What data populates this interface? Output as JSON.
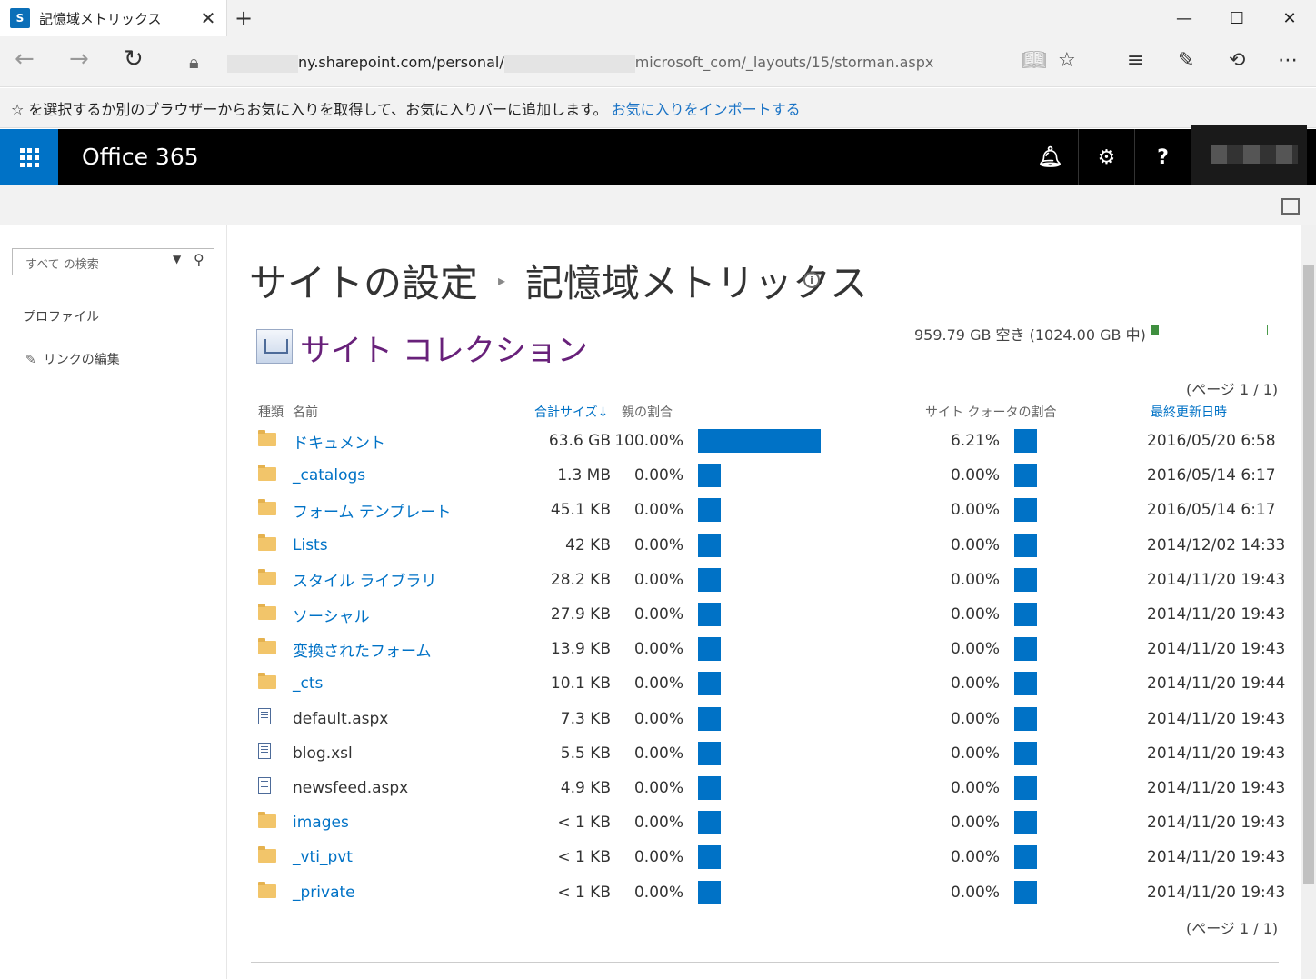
{
  "browser": {
    "tab_title": "記憶域メトリックス",
    "favicon_label": "S",
    "url_prefix": "ny.sharepoint.com/personal/",
    "url_suffix": "microsoft_com/_layouts/15/storman.aspx",
    "favorites_message": "☆ を選択するか別のブラウザーからお気に入りを取得して、お気に入りバーに追加します。",
    "favorites_import_link": "お気に入りをインポートする"
  },
  "suite": {
    "title": "Office 365"
  },
  "leftnav": {
    "search_placeholder": "すべて の検索",
    "items": [
      {
        "label": "プロファイル"
      },
      {
        "label": "リンクの編集"
      }
    ]
  },
  "page": {
    "breadcrumb_parent": "サイトの設定",
    "breadcrumb_current": "記憶域メトリックス",
    "section_title": "サイト コレクション",
    "quota_text": "959.79 GB 空き (1024.00 GB 中)",
    "quota_used_fraction": 0.06,
    "page_indicator_top": "(ページ 1 / 1)",
    "page_indicator_bottom": "(ページ 1 / 1)"
  },
  "table": {
    "headers": {
      "type": "種類",
      "name": "名前",
      "total_size": "合計サイズ",
      "parent_pct": "親の割合",
      "quota_pct": "サイト クォータの割合",
      "last_modified": "最終更新日時"
    },
    "rows": [
      {
        "kind": "folder",
        "name": "ドキュメント",
        "link": true,
        "size": "63.6 GB",
        "parent_pct": "100.00%",
        "parent_frac": 1.0,
        "quota_pct": "6.21%",
        "date": "2016/05/20 6:58"
      },
      {
        "kind": "folder",
        "name": "_catalogs",
        "link": true,
        "size": "1.3 MB",
        "parent_pct": "0.00%",
        "parent_frac": 0,
        "quota_pct": "0.00%",
        "date": "2016/05/14 6:17"
      },
      {
        "kind": "folder",
        "name": "フォーム テンプレート",
        "link": true,
        "size": "45.1 KB",
        "parent_pct": "0.00%",
        "parent_frac": 0,
        "quota_pct": "0.00%",
        "date": "2016/05/14 6:17"
      },
      {
        "kind": "folder",
        "name": "Lists",
        "link": true,
        "size": "42 KB",
        "parent_pct": "0.00%",
        "parent_frac": 0,
        "quota_pct": "0.00%",
        "date": "2014/12/02 14:33"
      },
      {
        "kind": "folder",
        "name": "スタイル ライブラリ",
        "link": true,
        "size": "28.2 KB",
        "parent_pct": "0.00%",
        "parent_frac": 0,
        "quota_pct": "0.00%",
        "date": "2014/11/20 19:43"
      },
      {
        "kind": "folder",
        "name": "ソーシャル",
        "link": true,
        "size": "27.9 KB",
        "parent_pct": "0.00%",
        "parent_frac": 0,
        "quota_pct": "0.00%",
        "date": "2014/11/20 19:43"
      },
      {
        "kind": "folder",
        "name": "変換されたフォーム",
        "link": true,
        "size": "13.9 KB",
        "parent_pct": "0.00%",
        "parent_frac": 0,
        "quota_pct": "0.00%",
        "date": "2014/11/20 19:43"
      },
      {
        "kind": "folder",
        "name": "_cts",
        "link": true,
        "size": "10.1 KB",
        "parent_pct": "0.00%",
        "parent_frac": 0,
        "quota_pct": "0.00%",
        "date": "2014/11/20 19:44"
      },
      {
        "kind": "file",
        "name": "default.aspx",
        "link": false,
        "size": "7.3 KB",
        "parent_pct": "0.00%",
        "parent_frac": 0,
        "quota_pct": "0.00%",
        "date": "2014/11/20 19:43"
      },
      {
        "kind": "file",
        "name": "blog.xsl",
        "link": false,
        "size": "5.5 KB",
        "parent_pct": "0.00%",
        "parent_frac": 0,
        "quota_pct": "0.00%",
        "date": "2014/11/20 19:43"
      },
      {
        "kind": "file",
        "name": "newsfeed.aspx",
        "link": false,
        "size": "4.9 KB",
        "parent_pct": "0.00%",
        "parent_frac": 0,
        "quota_pct": "0.00%",
        "date": "2014/11/20 19:43"
      },
      {
        "kind": "folder",
        "name": "images",
        "link": true,
        "size": "< 1 KB",
        "parent_pct": "0.00%",
        "parent_frac": 0,
        "quota_pct": "0.00%",
        "date": "2014/11/20 19:43"
      },
      {
        "kind": "folder",
        "name": "_vti_pvt",
        "link": true,
        "size": "< 1 KB",
        "parent_pct": "0.00%",
        "parent_frac": 0,
        "quota_pct": "0.00%",
        "date": "2014/11/20 19:43"
      },
      {
        "kind": "folder",
        "name": "_private",
        "link": true,
        "size": "< 1 KB",
        "parent_pct": "0.00%",
        "parent_frac": 0,
        "quota_pct": "0.00%",
        "date": "2014/11/20 19:43"
      }
    ]
  },
  "colors": {
    "accent": "#0072c6",
    "section_title": "#68217a",
    "quota_fill": "#3f8f3f"
  },
  "icons": {
    "folder": "folder-icon",
    "file": "file-icon"
  }
}
